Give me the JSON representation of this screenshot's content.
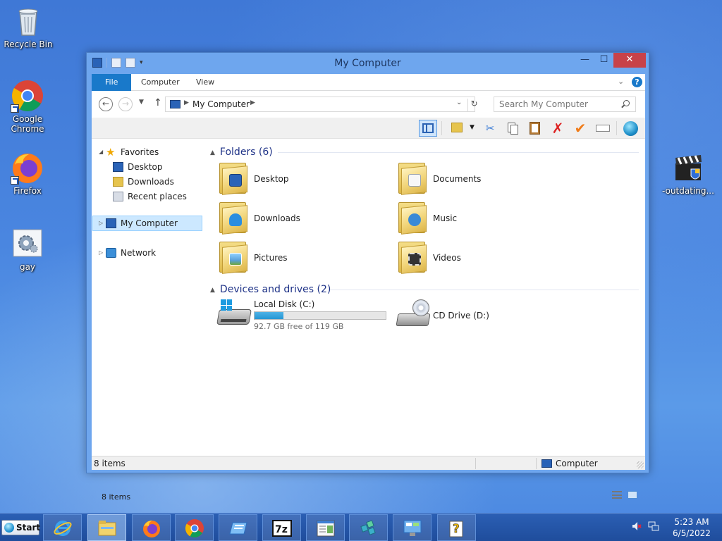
{
  "desktop": {
    "icons": [
      {
        "label": "Recycle Bin",
        "icon": "recycle-bin-icon"
      },
      {
        "label": "Google Chrome",
        "icon": "chrome-icon"
      },
      {
        "label": "Firefox",
        "icon": "firefox-icon"
      },
      {
        "label": "gay",
        "icon": "settings-file-icon"
      },
      {
        "label": "-outdating...",
        "icon": "video-clapper-icon"
      }
    ]
  },
  "window": {
    "title": "My Computer",
    "controls": {
      "minimize": "—",
      "maximize": "☐",
      "close": "✕"
    },
    "ribbon_tabs": [
      "File",
      "Computer",
      "View"
    ],
    "help": "?",
    "address": {
      "path": "My Computer"
    },
    "search": {
      "placeholder": "Search My Computer"
    },
    "nav_pane": {
      "favorites": "Favorites",
      "favorite_items": [
        "Desktop",
        "Downloads",
        "Recent places"
      ],
      "my_computer": "My Computer",
      "network": "Network"
    },
    "folders_header": "Folders (6)",
    "folders": [
      "Desktop",
      "Documents",
      "Downloads",
      "Music",
      "Pictures",
      "Videos"
    ],
    "devices_header": "Devices and drives (2)",
    "drives": {
      "local": {
        "name": "Local Disk (C:)",
        "free_text": "92.7 GB free of 119 GB",
        "used_fraction": 0.221
      },
      "cd": {
        "name": "CD Drive (D:)"
      }
    },
    "item_count_inner": "8 items",
    "status": {
      "left": "8 items",
      "right": "Computer"
    }
  },
  "taskbar": {
    "start_label": "Start",
    "apps": [
      "internet-explorer-icon",
      "file-explorer-icon",
      "firefox-icon",
      "chrome-icon",
      "remote-desktop-icon",
      "7zip-icon",
      "notepad-icon",
      "registry-editor-icon",
      "control-panel-icon",
      "help-icon"
    ],
    "clock": {
      "time": "5:23 AM",
      "date": "6/5/2022"
    }
  },
  "colors": {
    "accent": "#1979ca",
    "selection": "#cce8ff",
    "title_bar": "#6ea6ee",
    "desktop": "#4a86e0"
  }
}
